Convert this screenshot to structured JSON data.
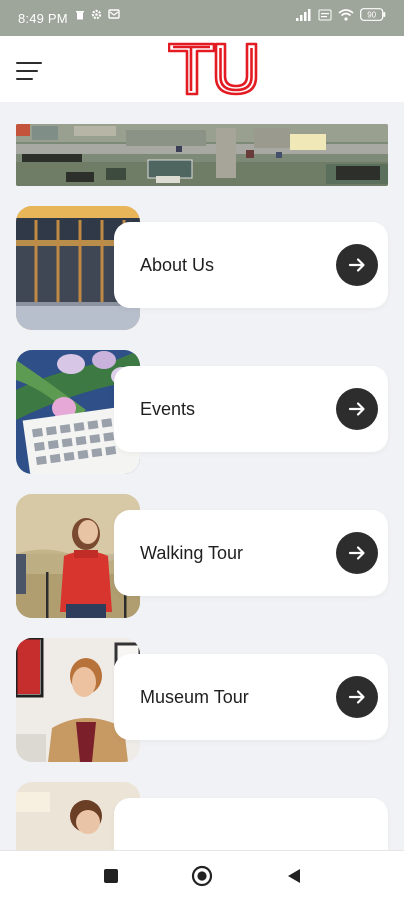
{
  "status": {
    "time": "8:49 PM",
    "battery": "90"
  },
  "header": {
    "logo_text": "TU"
  },
  "cards": [
    {
      "label": "About Us"
    },
    {
      "label": "Events"
    },
    {
      "label": "Walking Tour"
    },
    {
      "label": "Museum Tour"
    }
  ],
  "colors": {
    "brand_red": "#e31b23",
    "arrow_bg": "#2d2d2d",
    "status_bar": "#9ea59b"
  },
  "icons": {
    "menu": "hamburger-menu-icon",
    "arrow": "arrow-right-icon",
    "nav_recents": "square-recents-icon",
    "nav_home": "circle-home-icon",
    "nav_back": "triangle-back-icon"
  }
}
